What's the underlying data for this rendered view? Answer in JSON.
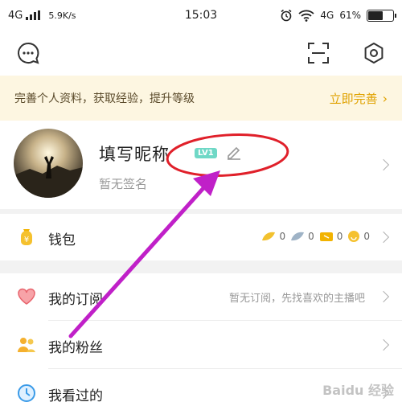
{
  "status_bar": {
    "network": "4G",
    "speed": "5.9K/s",
    "time": "15:03",
    "network_right": "4G",
    "battery": "61%",
    "battery_level": 0.61
  },
  "top_bar": {
    "icons": [
      "message-icon",
      "scan-icon",
      "settings-icon"
    ]
  },
  "promo": {
    "text": "完善个人资料，获取经验，提升等级",
    "action": "立即完善"
  },
  "profile": {
    "nickname": "填写昵称",
    "level": "LV1",
    "signature": "暂无签名"
  },
  "wallet": {
    "label": "钱包",
    "balances": [
      "0",
      "0",
      "0",
      "0"
    ]
  },
  "list": {
    "items": [
      {
        "label": "我的订阅",
        "sub": "暂无订阅，先找喜欢的主播吧"
      },
      {
        "label": "我的粉丝",
        "sub": ""
      },
      {
        "label": "我看过的",
        "sub": ""
      }
    ]
  },
  "colors": {
    "accent": "#e0a200",
    "annotation": "#c020c8",
    "highlight_circle": "#e0202a",
    "level_badge": "#6fd8c6"
  },
  "watermark": "Baidu 经验"
}
